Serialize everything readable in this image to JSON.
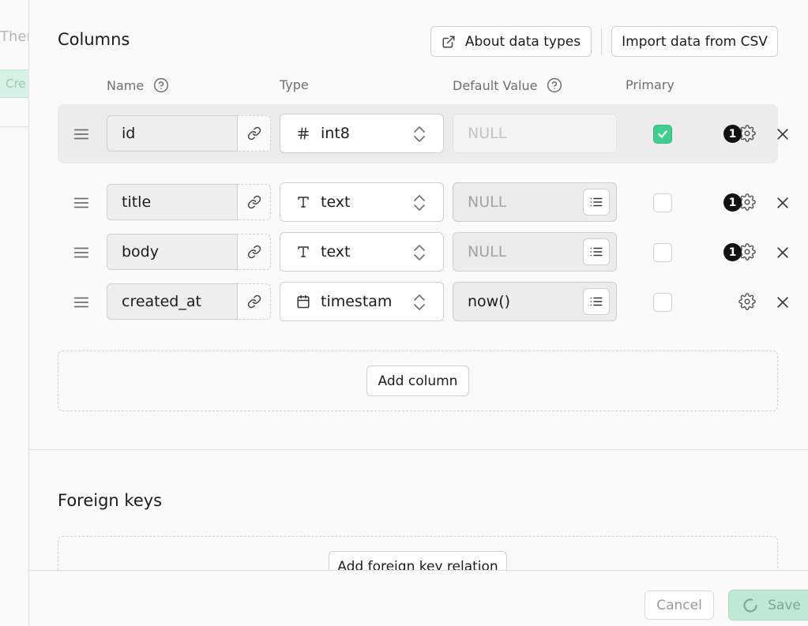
{
  "background": {
    "heading_fragment": "Ther",
    "button_fragment": "Cre"
  },
  "columns_section": {
    "title": "Columns",
    "about_button": "About data types",
    "import_button": "Import data from CSV",
    "headers": {
      "name": "Name",
      "type": "Type",
      "default": "Default Value",
      "primary": "Primary"
    },
    "rows": [
      {
        "name": "id",
        "type": "int8",
        "type_icon": "hash-icon",
        "default_value": "",
        "default_placeholder": "NULL",
        "primary": true,
        "badge": "1"
      },
      {
        "name": "title",
        "type": "text",
        "type_icon": "text-type-icon",
        "default_value": "",
        "default_placeholder": "NULL",
        "primary": false,
        "badge": "1"
      },
      {
        "name": "body",
        "type": "text",
        "type_icon": "text-type-icon",
        "default_value": "",
        "default_placeholder": "NULL",
        "primary": false,
        "badge": "1"
      },
      {
        "name": "created_at",
        "type": "timestam",
        "type_icon": "calendar-icon",
        "default_value": "now()",
        "default_placeholder": "",
        "primary": false,
        "badge": ""
      }
    ],
    "add_column_button": "Add column"
  },
  "foreign_keys_section": {
    "title": "Foreign keys",
    "add_relation_button": "Add foreign key relation"
  },
  "footer": {
    "cancel_button": "Cancel",
    "save_button": "Save"
  },
  "colors": {
    "primary_accent": "#3ecf8e",
    "save_bg": "#bfe9d4",
    "badge_bg": "#111111"
  }
}
